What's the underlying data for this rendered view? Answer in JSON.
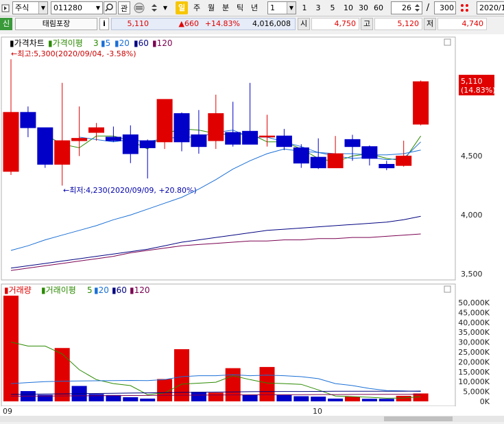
{
  "toolbar": {
    "market_select": "주식",
    "code_input": "011280",
    "watch_label": "관",
    "ilbong_label": "일",
    "period_labels": [
      "주",
      "월",
      "분",
      "틱",
      "년"
    ],
    "multiplier": "1",
    "count_buttons": [
      "1",
      "3",
      "5",
      "10",
      "30",
      "60"
    ],
    "visible_count": "26",
    "slash": "/",
    "total_count": "300",
    "date_input": "2020/1"
  },
  "infobar": {
    "badge": "신",
    "stock_name": "태림포장",
    "info_button": "i",
    "price": "5,110",
    "change": "▲660",
    "change_pct": "+14.83%",
    "volume": "4,016,008",
    "open_label": "시",
    "open_value": "4,750",
    "high_label": "고",
    "high_value": "5,120",
    "low_label": "저",
    "low_value": "4,740"
  },
  "colors": {
    "up": "#e00000",
    "down": "#0000c8",
    "ma_price_3": "#2a8a00",
    "ma_5": "#1a6fd6",
    "ma_20": "#1a6fd6",
    "ma_60": "#000080",
    "ma_120": "#7a0050"
  },
  "price_panel": {
    "legend": {
      "title": "가격차트",
      "ma_label": "가격이평",
      "periods": [
        "3",
        "5",
        "20",
        "60",
        "120"
      ]
    },
    "high_annotation": "←최고:5,300(2020/09/04, -3.58%)",
    "low_annotation": "←최저:4,230(2020/09/09, +20.80%)",
    "current_label": "5,110",
    "current_pct": "(14.83%)",
    "y_ticks": [
      "4,500",
      "4,000",
      "3,500"
    ]
  },
  "volume_panel": {
    "legend": {
      "title": "거래량",
      "ma_label": "거래이평",
      "periods": [
        "5",
        "20",
        "60",
        "120"
      ]
    },
    "y_ticks": [
      "50,000K",
      "45,000K",
      "40,000K",
      "35,000K",
      "30,000K",
      "25,000K",
      "20,000K",
      "15,000K",
      "10,000K",
      "5,000K",
      "0K"
    ]
  },
  "x_axis": {
    "month_labels": [
      "09",
      "10"
    ]
  },
  "chart_data": [
    {
      "type": "candlestick",
      "title": "가격차트",
      "ylim": [
        3400,
        5400
      ],
      "candles": [
        {
          "o": 4350,
          "h": 5300,
          "l": 4320,
          "c": 4850
        },
        {
          "o": 4850,
          "h": 4900,
          "l": 4640,
          "c": 4720
        },
        {
          "o": 4720,
          "h": 4720,
          "l": 4380,
          "c": 4410
        },
        {
          "o": 4410,
          "h": 5100,
          "l": 4230,
          "c": 4610
        },
        {
          "o": 4610,
          "h": 4900,
          "l": 4480,
          "c": 4630
        },
        {
          "o": 4680,
          "h": 4760,
          "l": 4610,
          "c": 4720
        },
        {
          "o": 4640,
          "h": 4730,
          "l": 4600,
          "c": 4610
        },
        {
          "o": 4660,
          "h": 4740,
          "l": 4420,
          "c": 4500
        },
        {
          "o": 4610,
          "h": 4620,
          "l": 4290,
          "c": 4550
        },
        {
          "o": 4600,
          "h": 4960,
          "l": 4540,
          "c": 4960
        },
        {
          "o": 4840,
          "h": 4850,
          "l": 4520,
          "c": 4600
        },
        {
          "o": 4660,
          "h": 4870,
          "l": 4500,
          "c": 4560
        },
        {
          "o": 4610,
          "h": 5000,
          "l": 4540,
          "c": 4840
        },
        {
          "o": 4680,
          "h": 4940,
          "l": 4560,
          "c": 4580
        },
        {
          "o": 4690,
          "h": 5100,
          "l": 4580,
          "c": 4580
        },
        {
          "o": 4650,
          "h": 4830,
          "l": 4560,
          "c": 4650
        },
        {
          "o": 4650,
          "h": 4710,
          "l": 4530,
          "c": 4560
        },
        {
          "o": 4550,
          "h": 4580,
          "l": 4380,
          "c": 4420
        },
        {
          "o": 4470,
          "h": 4630,
          "l": 4370,
          "c": 4380
        },
        {
          "o": 4380,
          "h": 4650,
          "l": 4380,
          "c": 4500
        },
        {
          "o": 4620,
          "h": 4660,
          "l": 4440,
          "c": 4560
        },
        {
          "o": 4560,
          "h": 4570,
          "l": 4400,
          "c": 4460
        },
        {
          "o": 4410,
          "h": 4440,
          "l": 4360,
          "c": 4380
        },
        {
          "o": 4400,
          "h": 4610,
          "l": 4390,
          "c": 4480
        },
        {
          "o": 4750,
          "h": 5120,
          "l": 4740,
          "c": 5110
        }
      ],
      "ma": [
        {
          "name": "3",
          "color": "#2a8a00",
          "values": [
            null,
            null,
            4660,
            4580,
            4550,
            4650,
            4650,
            4610,
            4540,
            4670,
            4710,
            4700,
            4670,
            4660,
            4670,
            4600,
            4600,
            4540,
            4460,
            4430,
            4480,
            4500,
            4460,
            4440,
            4650
          ]
        },
        {
          "name": "5",
          "color": "#1a6fd6",
          "values": [
            null,
            null,
            null,
            null,
            4640,
            4620,
            4600,
            4620,
            4600,
            4630,
            4640,
            4640,
            4680,
            4700,
            4640,
            4640,
            4600,
            4560,
            4510,
            4480,
            4460,
            4470,
            4450,
            4460,
            4600
          ]
        },
        {
          "name": "20",
          "color": "#1a6fd6",
          "values": [
            3680,
            3720,
            3770,
            3810,
            3850,
            3890,
            3940,
            3980,
            4030,
            4080,
            4130,
            4200,
            4280,
            4370,
            4440,
            4500,
            4540,
            4520,
            4510,
            4500,
            4500,
            4490,
            4490,
            4500,
            4530
          ]
        },
        {
          "name": "60",
          "color": "#000080",
          "values": [
            3530,
            3550,
            3570,
            3590,
            3610,
            3630,
            3650,
            3670,
            3690,
            3720,
            3750,
            3770,
            3790,
            3810,
            3830,
            3850,
            3860,
            3870,
            3880,
            3890,
            3900,
            3910,
            3920,
            3940,
            3970
          ]
        },
        {
          "name": "120",
          "color": "#7a0050",
          "values": [
            3510,
            3530,
            3550,
            3570,
            3590,
            3610,
            3630,
            3660,
            3680,
            3700,
            3720,
            3730,
            3740,
            3750,
            3760,
            3760,
            3770,
            3770,
            3780,
            3780,
            3790,
            3790,
            3800,
            3810,
            3820
          ]
        }
      ]
    },
    {
      "type": "bar",
      "title": "거래량",
      "ylim": [
        0,
        55000
      ],
      "unit": "K",
      "values": [
        53500,
        5200,
        3300,
        27000,
        7800,
        3700,
        3200,
        2100,
        1400,
        11300,
        26400,
        4800,
        4400,
        16800,
        3200,
        17400,
        3200,
        2600,
        2400,
        1400,
        2400,
        1300,
        1300,
        2800,
        4000
      ],
      "up": [
        true,
        false,
        false,
        true,
        false,
        false,
        false,
        false,
        false,
        true,
        true,
        false,
        true,
        true,
        false,
        true,
        false,
        false,
        false,
        false,
        true,
        false,
        false,
        true,
        true
      ],
      "ma": [
        {
          "name": "5",
          "color": "#2a8a00",
          "values": [
            30000,
            28000,
            28000,
            24000,
            16000,
            11000,
            9000,
            8000,
            3400,
            4300,
            8700,
            9200,
            9700,
            13000,
            11000,
            9300,
            9000,
            8600,
            5800,
            2700,
            2400,
            2100,
            1600,
            1700,
            2400
          ]
        },
        {
          "name": "20",
          "color": "#1a6fd6",
          "values": [
            9000,
            9500,
            10000,
            10200,
            10300,
            10400,
            10500,
            10600,
            10500,
            11000,
            12500,
            13000,
            13000,
            13500,
            13000,
            13300,
            13000,
            12500,
            11500,
            9000,
            8000,
            6500,
            5500,
            5300,
            5000
          ]
        },
        {
          "name": "60",
          "color": "#000080",
          "values": [
            3500,
            3600,
            3700,
            3800,
            3900,
            4000,
            4100,
            4200,
            4300,
            4400,
            4500,
            4600,
            4700,
            4800,
            4900,
            4950,
            5000,
            5000,
            5050,
            5100,
            5100,
            5150,
            5150,
            5150,
            5200
          ]
        },
        {
          "name": "120",
          "color": "#7a0050",
          "values": [
            2600,
            2650,
            2700,
            2750,
            2800,
            2850,
            2900,
            2950,
            3000,
            3050,
            3100,
            3150,
            3200,
            3250,
            3300,
            3350,
            3400,
            3400,
            3450,
            3450,
            3500,
            3500,
            3550,
            3550,
            3600
          ]
        }
      ]
    }
  ]
}
